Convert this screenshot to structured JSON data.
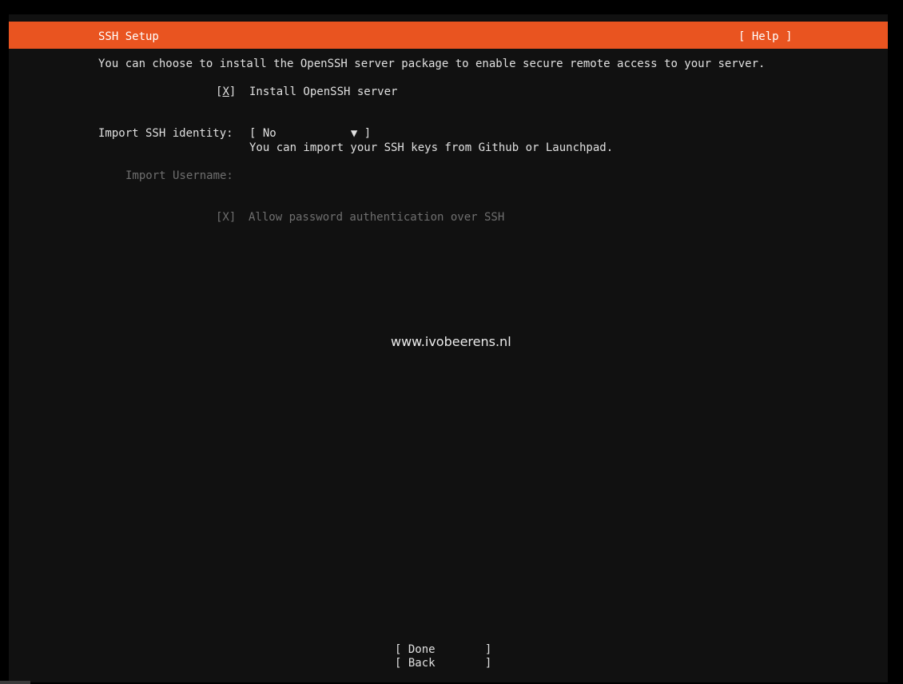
{
  "header": {
    "title": "SSH Setup",
    "help_label": "[ Help ]",
    "color": "#e95420"
  },
  "intro_text": "You can choose to install the OpenSSH server package to enable secure remote access to your server.",
  "install_openssh": {
    "checkbox_open": "[",
    "checkbox_mark": "X",
    "checkbox_close": "]",
    "label": "Install OpenSSH server"
  },
  "import_identity": {
    "label": "Import SSH identity:",
    "select_open": "[ ",
    "selected_value": "No",
    "select_close": "▼ ]",
    "hint": "You can import your SSH keys from Github or Launchpad."
  },
  "import_username": {
    "label": "Import Username:"
  },
  "password_auth": {
    "checkbox": "[X]",
    "label": "Allow password authentication over SSH"
  },
  "watermark": "www.ivobeerens.nl",
  "buttons": {
    "done_open": "[ ",
    "done_label": "Done",
    "done_close": "]",
    "back_open": "[ ",
    "back_label": "Back",
    "back_close": "]"
  }
}
